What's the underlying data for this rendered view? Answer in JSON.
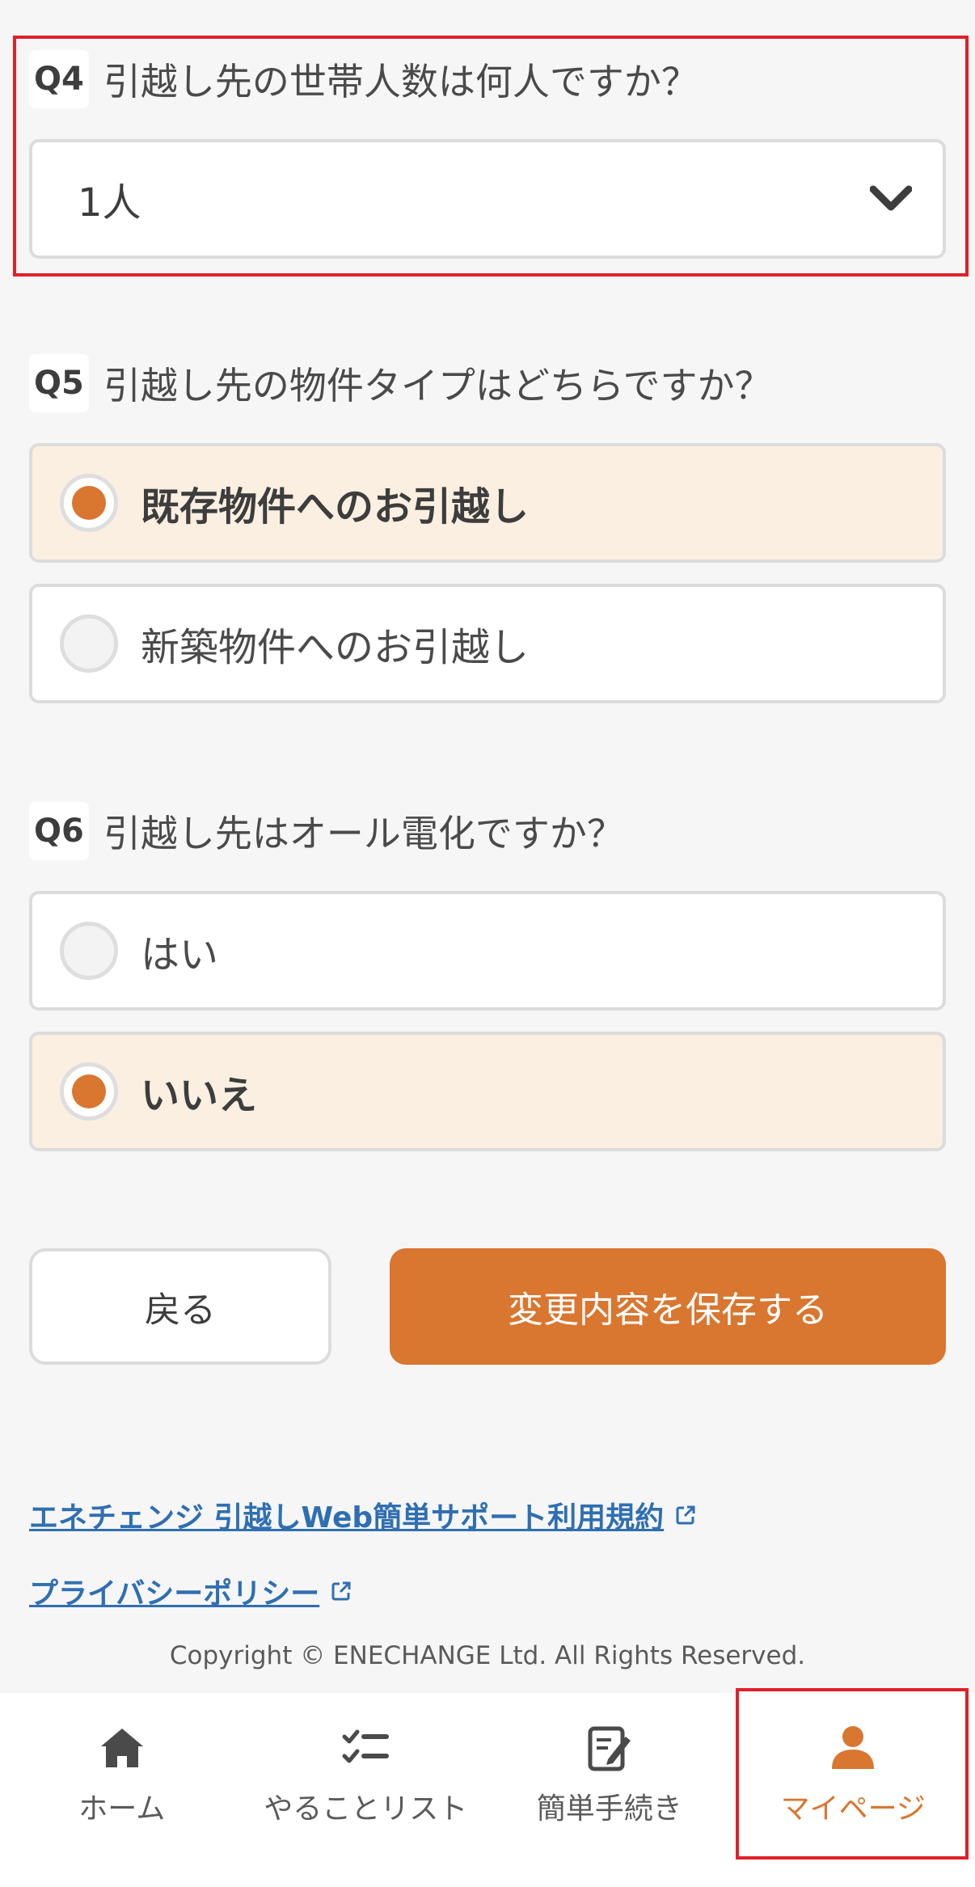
{
  "q4": {
    "badge": "Q4",
    "text": "引越し先の世帯人数は何人ですか？",
    "select_value": "1人"
  },
  "q5": {
    "badge": "Q5",
    "text": "引越し先の物件タイプはどちらですか？",
    "options": [
      {
        "label": "既存物件へのお引越し",
        "selected": true
      },
      {
        "label": "新築物件へのお引越し",
        "selected": false
      }
    ]
  },
  "q6": {
    "badge": "Q6",
    "text": "引越し先はオール電化ですか？",
    "options": [
      {
        "label": "はい",
        "selected": false
      },
      {
        "label": "いいえ",
        "selected": true
      }
    ]
  },
  "buttons": {
    "back_label": "戻る",
    "save_label": "変更内容を保存する"
  },
  "links": {
    "terms": "エネチェンジ 引越しWeb簡単サポート利用規約",
    "privacy": "プライバシーポリシー"
  },
  "copyright": "Copyright © ENECHANGE Ltd. All Rights Reserved.",
  "bottom_nav": {
    "items": [
      {
        "label": "ホーム",
        "icon": "home-icon"
      },
      {
        "label": "やることリスト",
        "icon": "checklist-icon"
      },
      {
        "label": "簡単手続き",
        "icon": "edit-document-icon"
      },
      {
        "label": "マイページ",
        "icon": "user-icon",
        "active": true
      }
    ]
  },
  "colors": {
    "accent": "#d9762f",
    "selected_bg": "#fbefe1",
    "link": "#2f6fb1",
    "highlight": "#e0202a"
  }
}
